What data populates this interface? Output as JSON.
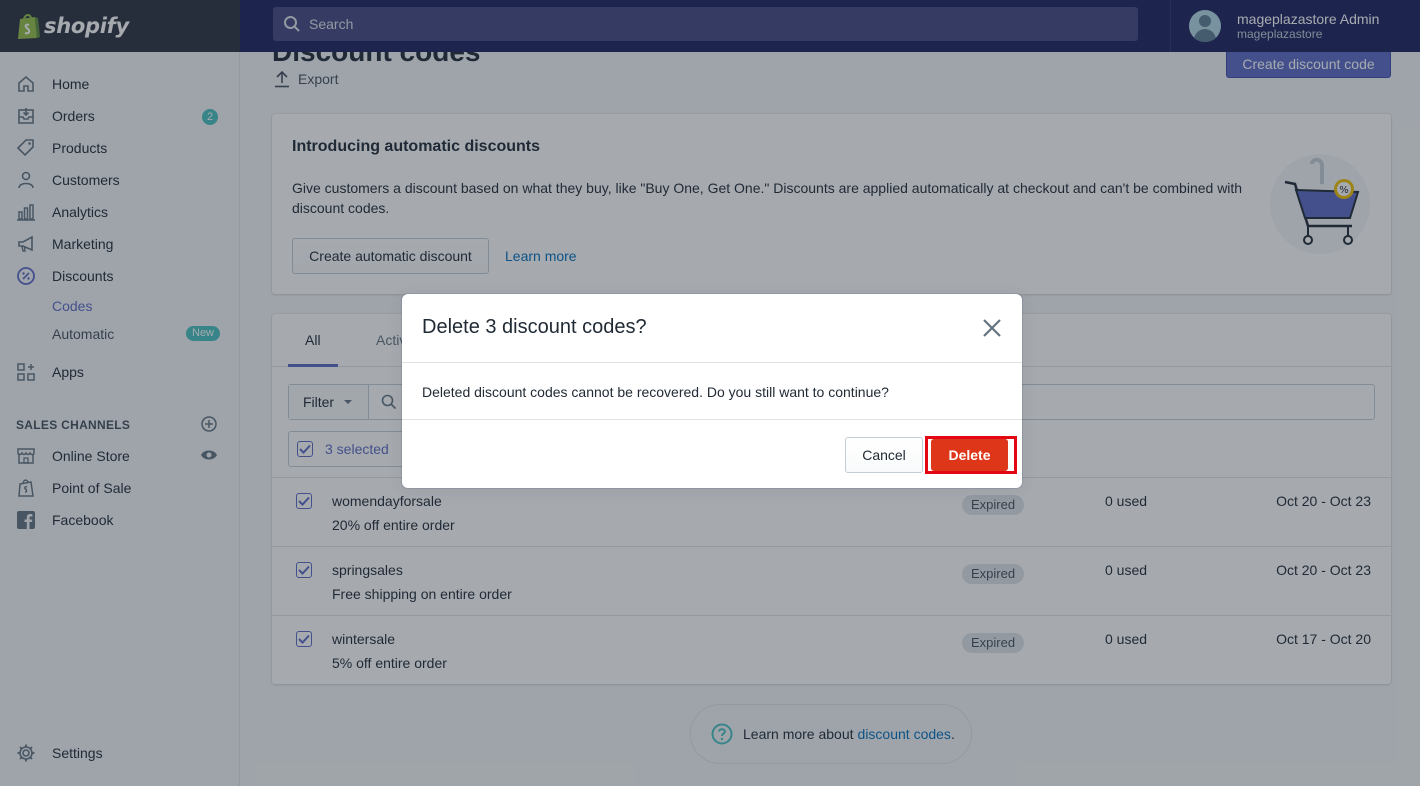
{
  "app": {
    "brand": "shopify"
  },
  "search": {
    "placeholder": "Search"
  },
  "user": {
    "name": "mageplazastore Admin",
    "store": "mageplazastore"
  },
  "sidebar": {
    "items": [
      {
        "label": "Home",
        "icon": "home-icon"
      },
      {
        "label": "Orders",
        "icon": "orders-icon",
        "badge": "2"
      },
      {
        "label": "Products",
        "icon": "tag-icon"
      },
      {
        "label": "Customers",
        "icon": "person-icon"
      },
      {
        "label": "Analytics",
        "icon": "bar-chart-icon"
      },
      {
        "label": "Marketing",
        "icon": "megaphone-icon"
      },
      {
        "label": "Discounts",
        "icon": "discount-icon"
      },
      {
        "label": "Apps",
        "icon": "apps-icon"
      }
    ],
    "discount_sub": {
      "codes": "Codes",
      "automatic": "Automatic",
      "new_badge": "New"
    },
    "sales_channels_label": "SALES CHANNELS",
    "channels": [
      {
        "label": "Online Store",
        "icon": "store-icon"
      },
      {
        "label": "Point of Sale",
        "icon": "bag-icon"
      },
      {
        "label": "Facebook",
        "icon": "facebook-icon"
      }
    ],
    "settings": "Settings"
  },
  "page": {
    "title": "Discount codes",
    "export": "Export",
    "create_button": "Create discount code"
  },
  "promo": {
    "title": "Introducing automatic discounts",
    "description": "Give customers a discount based on what they buy, like \"Buy One, Get One.\" Discounts are applied automatically at checkout and can't be combined with discount codes.",
    "button": "Create automatic discount",
    "link": "Learn more"
  },
  "list": {
    "tabs": [
      "All",
      "Active"
    ],
    "filter": "Filter",
    "selected": "3 selected",
    "rows": [
      {
        "code": "womendayforsale",
        "desc": "20% off entire order",
        "status": "Expired",
        "used": "0 used",
        "dates": "Oct 20 - Oct 23"
      },
      {
        "code": "springsales",
        "desc": "Free shipping on entire order",
        "status": "Expired",
        "used": "0 used",
        "dates": "Oct 20 - Oct 23"
      },
      {
        "code": "wintersale",
        "desc": "5% off entire order",
        "status": "Expired",
        "used": "0 used",
        "dates": "Oct 17 - Oct 20"
      }
    ]
  },
  "footer": {
    "prefix": "Learn more about",
    "link": "discount codes",
    "suffix": "."
  },
  "modal": {
    "title": "Delete 3 discount codes?",
    "body": "Deleted discount codes cannot be recovered. Do you still want to continue?",
    "cancel": "Cancel",
    "delete": "Delete"
  },
  "colors": {
    "topbar": "#1c2260",
    "accent": "#5c6ac4",
    "danger": "#de3618",
    "highlight": "#e30613"
  }
}
